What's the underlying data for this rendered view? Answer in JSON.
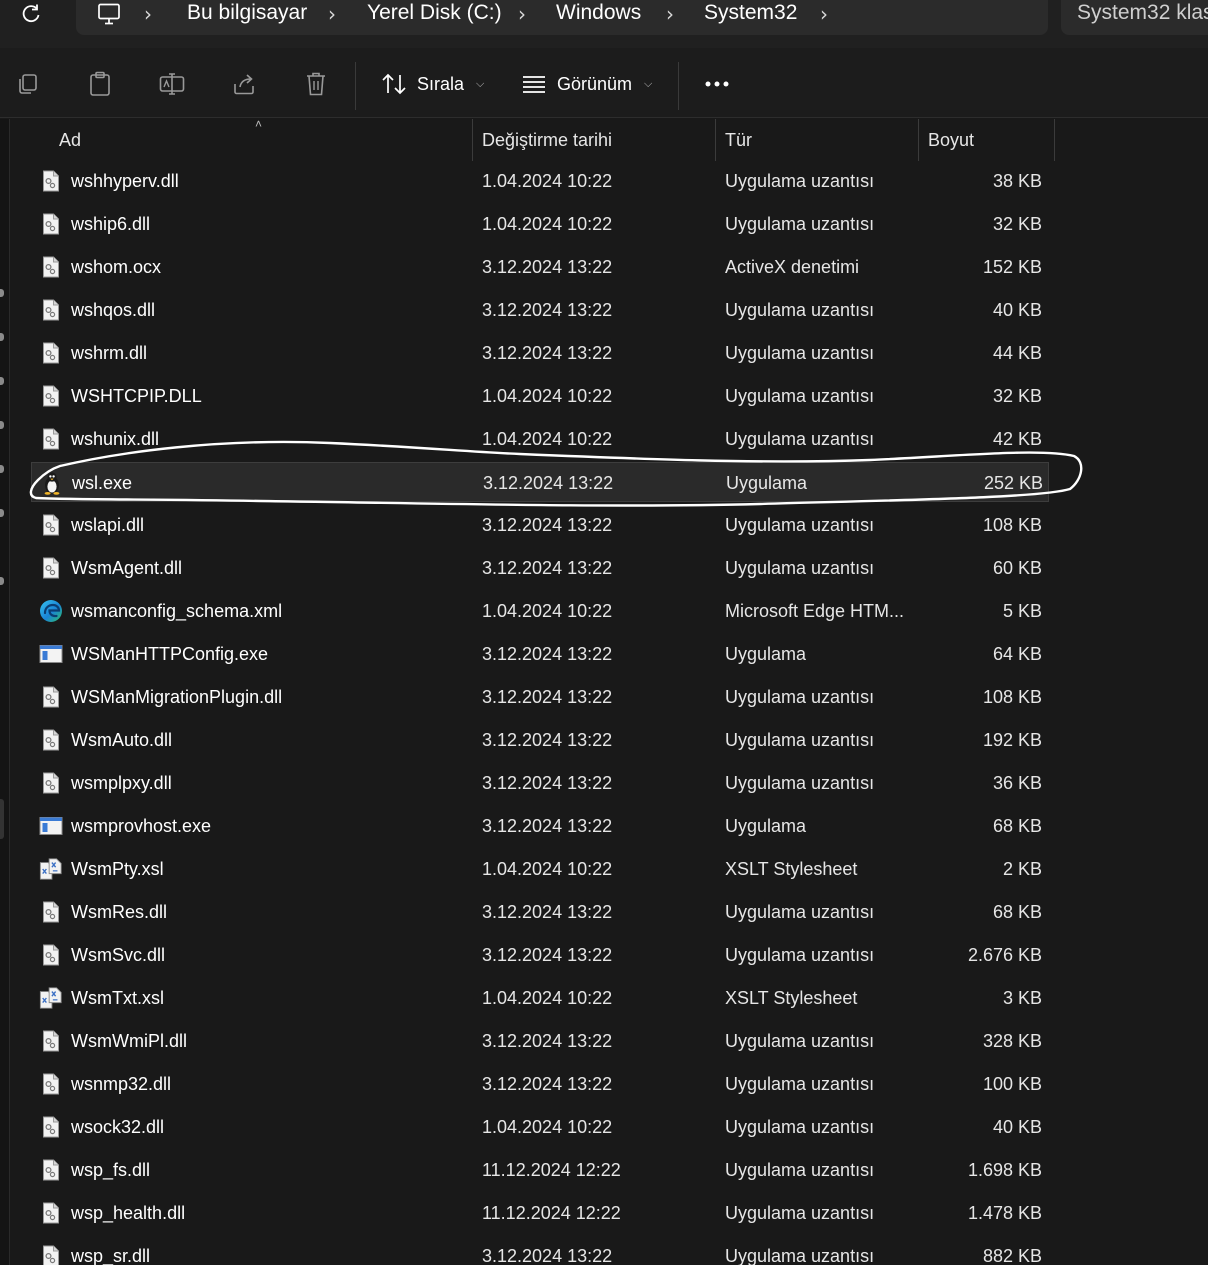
{
  "address_bar": {
    "crumbs": [
      "Bu bilgisayar",
      "Yerel Disk (C:)",
      "Windows",
      "System32"
    ],
    "search_placeholder": "System32 klas"
  },
  "command_bar": {
    "sort_label": "Sırala",
    "view_label": "Görünüm"
  },
  "columns": {
    "name": "Ad",
    "date": "Değiştirme tarihi",
    "type": "Tür",
    "size": "Boyut"
  },
  "files": [
    {
      "name": "wshhyperv.dll",
      "date": "1.04.2024 10:22",
      "type": "Uygulama uzantısı",
      "size": "38 KB",
      "icon": "dll-icon"
    },
    {
      "name": "wship6.dll",
      "date": "1.04.2024 10:22",
      "type": "Uygulama uzantısı",
      "size": "32 KB",
      "icon": "dll-icon"
    },
    {
      "name": "wshom.ocx",
      "date": "3.12.2024 13:22",
      "type": "ActiveX denetimi",
      "size": "152 KB",
      "icon": "dll-icon"
    },
    {
      "name": "wshqos.dll",
      "date": "3.12.2024 13:22",
      "type": "Uygulama uzantısı",
      "size": "40 KB",
      "icon": "dll-icon"
    },
    {
      "name": "wshrm.dll",
      "date": "3.12.2024 13:22",
      "type": "Uygulama uzantısı",
      "size": "44 KB",
      "icon": "dll-icon"
    },
    {
      "name": "WSHTCPIP.DLL",
      "date": "1.04.2024 10:22",
      "type": "Uygulama uzantısı",
      "size": "32 KB",
      "icon": "dll-icon"
    },
    {
      "name": "wshunix.dll",
      "date": "1.04.2024 10:22",
      "type": "Uygulama uzantısı",
      "size": "42 KB",
      "icon": "dll-icon"
    },
    {
      "name": "wsl.exe",
      "date": "3.12.2024 13:22",
      "type": "Uygulama",
      "size": "252 KB",
      "icon": "linux-penguin-icon",
      "selected": true
    },
    {
      "name": "wslapi.dll",
      "date": "3.12.2024 13:22",
      "type": "Uygulama uzantısı",
      "size": "108 KB",
      "icon": "dll-icon"
    },
    {
      "name": "WsmAgent.dll",
      "date": "3.12.2024 13:22",
      "type": "Uygulama uzantısı",
      "size": "60 KB",
      "icon": "dll-icon"
    },
    {
      "name": "wsmanconfig_schema.xml",
      "date": "1.04.2024 10:22",
      "type": "Microsoft Edge HTM...",
      "size": "5 KB",
      "icon": "edge-icon"
    },
    {
      "name": "WSManHTTPConfig.exe",
      "date": "3.12.2024 13:22",
      "type": "Uygulama",
      "size": "64 KB",
      "icon": "exe-window-icon"
    },
    {
      "name": "WSManMigrationPlugin.dll",
      "date": "3.12.2024 13:22",
      "type": "Uygulama uzantısı",
      "size": "108 KB",
      "icon": "dll-icon"
    },
    {
      "name": "WsmAuto.dll",
      "date": "3.12.2024 13:22",
      "type": "Uygulama uzantısı",
      "size": "192 KB",
      "icon": "dll-icon"
    },
    {
      "name": "wsmplpxy.dll",
      "date": "3.12.2024 13:22",
      "type": "Uygulama uzantısı",
      "size": "36 KB",
      "icon": "dll-icon"
    },
    {
      "name": "wsmprovhost.exe",
      "date": "3.12.2024 13:22",
      "type": "Uygulama",
      "size": "68 KB",
      "icon": "exe-window-icon"
    },
    {
      "name": "WsmPty.xsl",
      "date": "1.04.2024 10:22",
      "type": "XSLT Stylesheet",
      "size": "2 KB",
      "icon": "xsl-icon"
    },
    {
      "name": "WsmRes.dll",
      "date": "3.12.2024 13:22",
      "type": "Uygulama uzantısı",
      "size": "68 KB",
      "icon": "dll-icon"
    },
    {
      "name": "WsmSvc.dll",
      "date": "3.12.2024 13:22",
      "type": "Uygulama uzantısı",
      "size": "2.676 KB",
      "icon": "dll-icon"
    },
    {
      "name": "WsmTxt.xsl",
      "date": "1.04.2024 10:22",
      "type": "XSLT Stylesheet",
      "size": "3 KB",
      "icon": "xsl-icon"
    },
    {
      "name": "WsmWmiPl.dll",
      "date": "3.12.2024 13:22",
      "type": "Uygulama uzantısı",
      "size": "328 KB",
      "icon": "dll-icon"
    },
    {
      "name": "wsnmp32.dll",
      "date": "3.12.2024 13:22",
      "type": "Uygulama uzantısı",
      "size": "100 KB",
      "icon": "dll-icon"
    },
    {
      "name": "wsock32.dll",
      "date": "1.04.2024 10:22",
      "type": "Uygulama uzantısı",
      "size": "40 KB",
      "icon": "dll-icon"
    },
    {
      "name": "wsp_fs.dll",
      "date": "11.12.2024 12:22",
      "type": "Uygulama uzantısı",
      "size": "1.698 KB",
      "icon": "dll-icon"
    },
    {
      "name": "wsp_health.dll",
      "date": "11.12.2024 12:22",
      "type": "Uygulama uzantısı",
      "size": "1.478 KB",
      "icon": "dll-icon"
    },
    {
      "name": "wsp_sr.dll",
      "date": "3.12.2024 13:22",
      "type": "Uygulama uzantısı",
      "size": "882 KB",
      "icon": "dll-icon"
    }
  ],
  "colors": {
    "background": "#191919",
    "toolbar": "#1c1c1c",
    "addressbar": "#2b2b2b",
    "selected_row": "#2a2a2a",
    "annotation_stroke": "#ffffff"
  }
}
